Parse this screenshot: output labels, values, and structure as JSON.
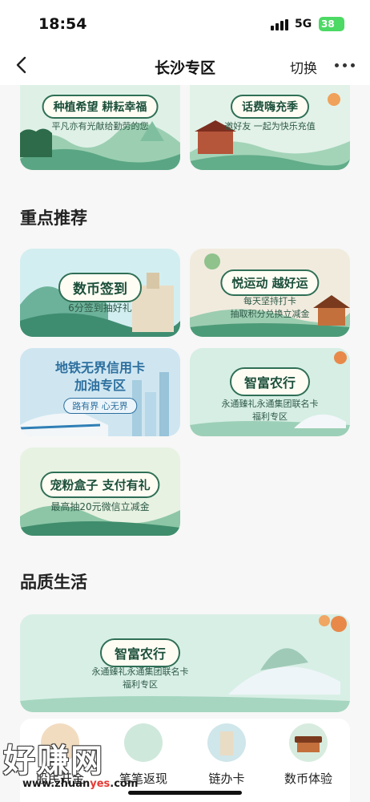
{
  "status_bar": {
    "time": "18:54",
    "network": "5G",
    "battery": "38"
  },
  "nav": {
    "title": "长沙专区",
    "switch_label": "切换"
  },
  "top_banners": [
    {
      "title": "种植希望 耕耘幸福",
      "subtitle": "平凡亦有光献给勤劳的您"
    },
    {
      "title": "话费嗨充季",
      "subtitle": "邀好友 一起为快乐充值"
    }
  ],
  "featured": {
    "heading": "重点推荐",
    "cards": [
      {
        "title": "数币签到",
        "subtitle": "6分签到抽好礼"
      },
      {
        "title": "悦运动 越好运",
        "subtitle_line1": "每天坚持打卡",
        "subtitle_line2": "抽取积分兑换立减金"
      },
      {
        "title_line1": "地铁无界信用卡",
        "title_line2": "加油专区",
        "subtitle": "路有界 心无界"
      },
      {
        "title": "智富农行",
        "subtitle_line1": "永通臻礼永通集团联名卡",
        "subtitle_line2": "福利专区"
      },
      {
        "title": "宠粉盒子 支付有礼",
        "subtitle": "最高抽20元微信立减金"
      }
    ]
  },
  "quality_life": {
    "heading": "品质生活",
    "banner": {
      "title": "智富农行",
      "subtitle_line1": "永通臻礼永通集团联名卡",
      "subtitle_line2": "福利专区"
    },
    "shortcuts": [
      {
        "label": "股民开金"
      },
      {
        "label": "笔笔返现"
      },
      {
        "label": "链办卡"
      },
      {
        "label": "数币体验"
      }
    ]
  },
  "watermark": {
    "text": "好赚网",
    "url_prefix": "www.zhuan",
    "url_highlight": "yes",
    "url_suffix": ".com"
  },
  "colors": {
    "accent_green": "#2f6f56",
    "card_mint": "#d9efe4",
    "battery_green": "#4cd964"
  }
}
